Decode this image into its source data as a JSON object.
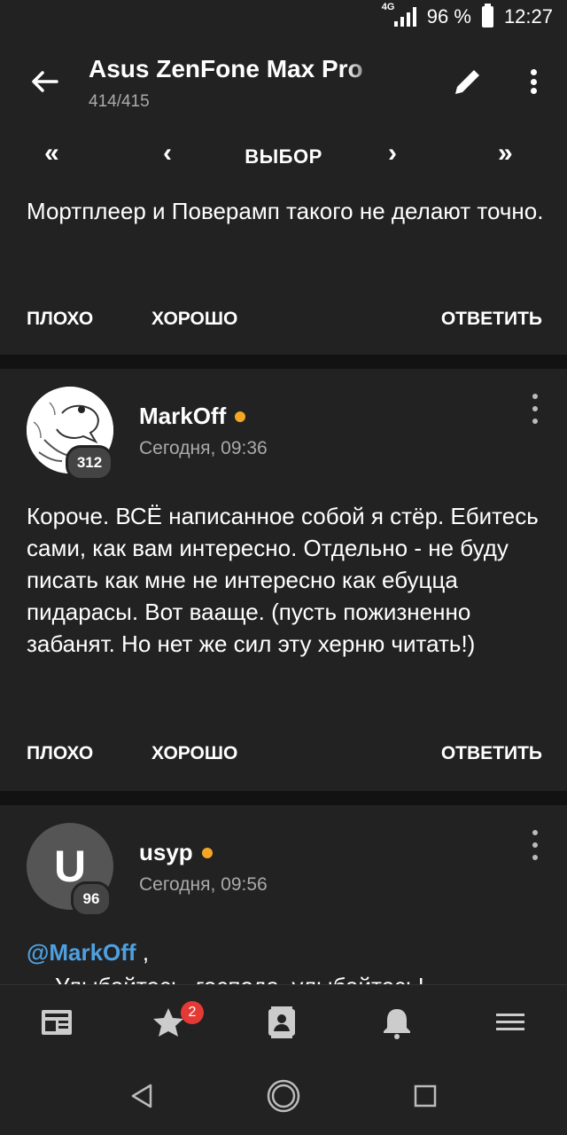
{
  "status": {
    "network": "4G",
    "battery": "96 %",
    "time": "12:27"
  },
  "appbar": {
    "title": "Asus ZenFone Max Pro",
    "subtitle": "414/415"
  },
  "pager": {
    "first": "«",
    "prev": "‹",
    "select": "ВЫБОР",
    "next": "›",
    "last": "»"
  },
  "posts": [
    {
      "text": "Мортплеер и Поверамп такого не делают точно.",
      "actions": {
        "bad": "ПЛОХО",
        "good": "ХОРОШО",
        "reply": "ОТВЕТИТЬ"
      }
    },
    {
      "author": "MarkOff",
      "reputation": "312",
      "time": "Сегодня, 09:36",
      "text": "Короче. ВСЁ написанное собой я стёр. Ебитесь сами, как вам интересно. Отдельно - не буду писать как мне не интересно как ебуцца пидарасы. Вот вааще. (пусть пожизненно забанят. Но нет же сил эту херню читать!)",
      "actions": {
        "bad": "ПЛОХО",
        "good": "ХОРОШО",
        "reply": "ОТВЕТИТЬ"
      }
    },
    {
      "author": "usyp",
      "avatar_letter": "U",
      "reputation": "96",
      "time": "Сегодня, 09:56",
      "mention": "@MarkOff",
      "mention_suffix": " ,",
      "text": "Улыбайтесь, господа, улыбайтесь!"
    }
  ],
  "bottomnav": {
    "favorites_count": "2"
  },
  "colors": {
    "background": "#121212",
    "surface": "#222222",
    "accent_online": "#f5a623",
    "link": "#4ea0e0",
    "badge_red": "#e53935"
  }
}
